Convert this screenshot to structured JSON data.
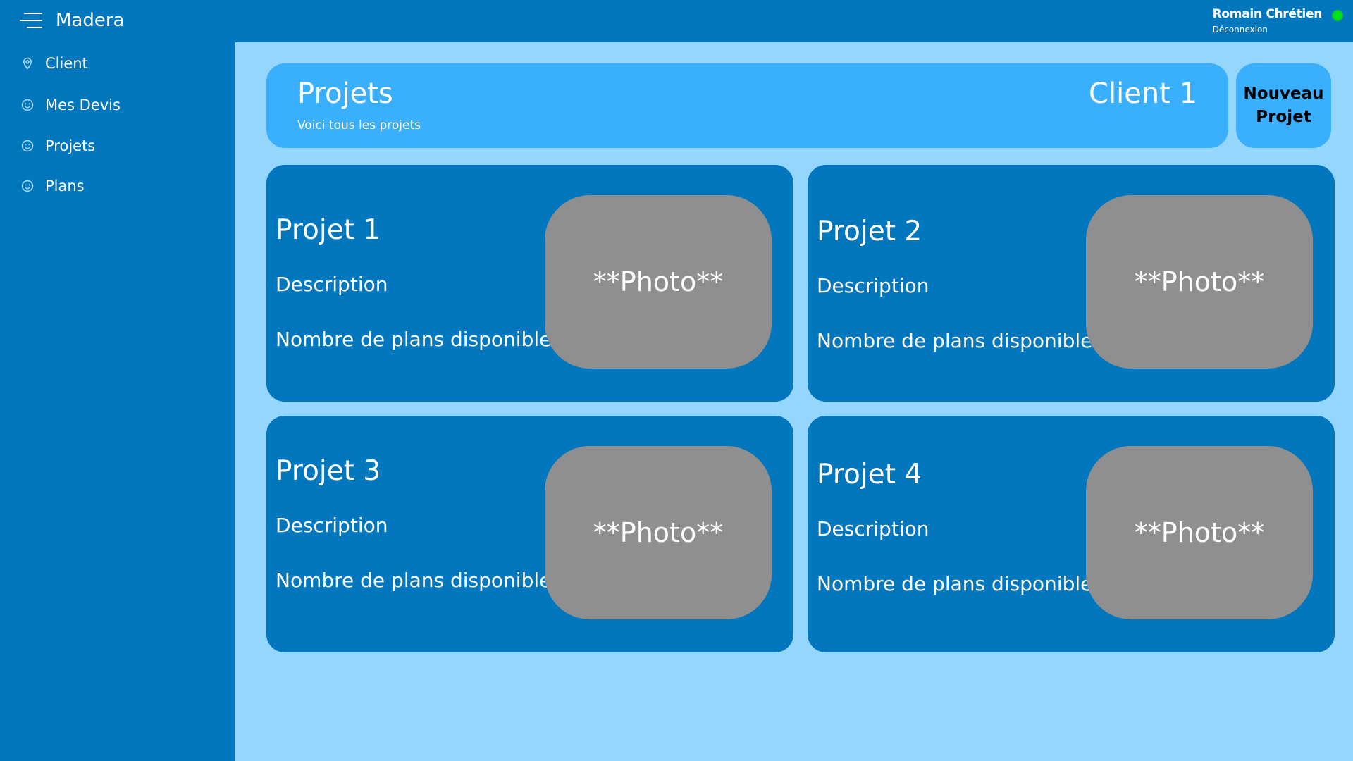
{
  "app": {
    "title": "Madera"
  },
  "user": {
    "name": "Romain Chrétien",
    "logout_label": "Déconnexion",
    "status_color": "#00e21d"
  },
  "sidebar": {
    "items": [
      {
        "label": "Client",
        "icon": "location-pin-icon"
      },
      {
        "label": "Mes Devis",
        "icon": "smiley-icon"
      },
      {
        "label": "Projets",
        "icon": "smiley-icon"
      },
      {
        "label": "Plans",
        "icon": "smiley-icon"
      }
    ]
  },
  "header": {
    "title": "Projets",
    "subtitle": "Voici tous les projets",
    "client": "Client 1",
    "new_project_label": "Nouveau Projet"
  },
  "projects": [
    {
      "title": "Projet 1",
      "description": "Description",
      "plans": "Nombre de plans disponibles",
      "photo": "**Photo**"
    },
    {
      "title": "Projet 2",
      "description": "Description",
      "plans": "Nombre de plans disponibles",
      "photo": "**Photo**"
    },
    {
      "title": "Projet 3",
      "description": "Description",
      "plans": "Nombre de plans disponibles",
      "photo": "**Photo**"
    },
    {
      "title": "Projet 4",
      "description": "Description",
      "plans": "Nombre de plans disponibles",
      "photo": "**Photo**"
    }
  ],
  "colors": {
    "topbar": "#0277bd",
    "sidebar": "#0277bd",
    "content_background": "#94d6fd",
    "header_card": "#3aaffe",
    "project_card": "#0277bd",
    "photo_placeholder": "#8f8f8f"
  }
}
